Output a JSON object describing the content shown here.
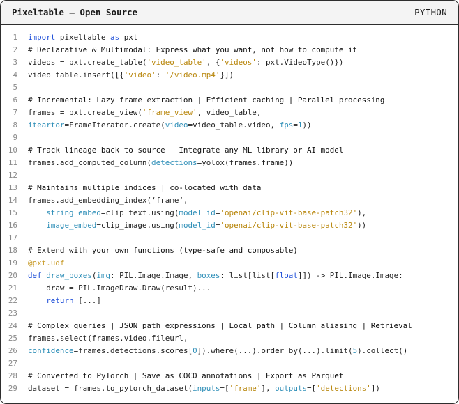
{
  "window": {
    "title": "Pixeltable — Open Source",
    "language": "PYTHON"
  },
  "code_lines": [
    {
      "n": "1",
      "tokens": [
        {
          "c": "kw",
          "t": "import"
        },
        {
          "c": "",
          "t": " pixeltable "
        },
        {
          "c": "kw",
          "t": "as"
        },
        {
          "c": "",
          "t": " pxt"
        }
      ]
    },
    {
      "n": "2",
      "tokens": [
        {
          "c": "cm",
          "t": "# Declarative & Multimodal: Express what you want, not how to compute it"
        }
      ]
    },
    {
      "n": "3",
      "tokens": [
        {
          "c": "",
          "t": "videos = pxt.create_table("
        },
        {
          "c": "st",
          "t": "'video_table'"
        },
        {
          "c": "",
          "t": ", {"
        },
        {
          "c": "st",
          "t": "'videos'"
        },
        {
          "c": "",
          "t": ": pxt.VideoType()})"
        }
      ]
    },
    {
      "n": "4",
      "tokens": [
        {
          "c": "",
          "t": "video_table.insert([{"
        },
        {
          "c": "st",
          "t": "'video'"
        },
        {
          "c": "",
          "t": ": "
        },
        {
          "c": "st",
          "t": "'/video.mp4'"
        },
        {
          "c": "",
          "t": "}])"
        }
      ]
    },
    {
      "n": "5",
      "tokens": []
    },
    {
      "n": "6",
      "tokens": [
        {
          "c": "cm",
          "t": "# Incremental: Lazy frame extraction | Efficient caching | Parallel processing"
        }
      ]
    },
    {
      "n": "7",
      "tokens": [
        {
          "c": "",
          "t": "frames = pxt.create_view("
        },
        {
          "c": "st",
          "t": "'frame_view'"
        },
        {
          "c": "",
          "t": ", video_table,"
        }
      ]
    },
    {
      "n": "8",
      "tokens": [
        {
          "c": "fn",
          "t": "iteartor"
        },
        {
          "c": "",
          "t": "=FrameIterator.create("
        },
        {
          "c": "fn",
          "t": "video"
        },
        {
          "c": "",
          "t": "=video_table.video, "
        },
        {
          "c": "fn",
          "t": "fps"
        },
        {
          "c": "",
          "t": "="
        },
        {
          "c": "nm",
          "t": "1"
        },
        {
          "c": "",
          "t": "))"
        }
      ]
    },
    {
      "n": "9",
      "tokens": []
    },
    {
      "n": "10",
      "tokens": [
        {
          "c": "cm",
          "t": "# Track lineage back to source | Integrate any ML library or AI model"
        }
      ]
    },
    {
      "n": "11",
      "tokens": [
        {
          "c": "",
          "t": "frames.add_computed_column("
        },
        {
          "c": "fn",
          "t": "detections"
        },
        {
          "c": "",
          "t": "=yolox(frames.frame))"
        }
      ]
    },
    {
      "n": "12",
      "tokens": []
    },
    {
      "n": "13",
      "tokens": [
        {
          "c": "cm",
          "t": "# Maintains multiple indices | co-located with data"
        }
      ]
    },
    {
      "n": "14",
      "tokens": [
        {
          "c": "",
          "t": "frames.add_embedding_index(‘frame’,"
        }
      ]
    },
    {
      "n": "15",
      "tokens": [
        {
          "c": "",
          "t": "    "
        },
        {
          "c": "fn",
          "t": "string_embed"
        },
        {
          "c": "",
          "t": "=clip_text.using("
        },
        {
          "c": "fn",
          "t": "model_id"
        },
        {
          "c": "",
          "t": "="
        },
        {
          "c": "st",
          "t": "'openai/clip-vit-base-patch32'"
        },
        {
          "c": "",
          "t": "),"
        }
      ]
    },
    {
      "n": "16",
      "tokens": [
        {
          "c": "",
          "t": "    "
        },
        {
          "c": "fn",
          "t": "image_embed"
        },
        {
          "c": "",
          "t": "=clip_image.using("
        },
        {
          "c": "fn",
          "t": "model_id"
        },
        {
          "c": "",
          "t": "="
        },
        {
          "c": "st",
          "t": "'openai/clip-vit-base-patch32'"
        },
        {
          "c": "",
          "t": "))"
        }
      ]
    },
    {
      "n": "17",
      "tokens": []
    },
    {
      "n": "18",
      "tokens": [
        {
          "c": "cm",
          "t": "# Extend with your own functions (type-safe and composable)"
        }
      ]
    },
    {
      "n": "19",
      "tokens": [
        {
          "c": "at",
          "t": "@pxt.udf"
        }
      ]
    },
    {
      "n": "20",
      "tokens": [
        {
          "c": "kw",
          "t": "def"
        },
        {
          "c": "",
          "t": " "
        },
        {
          "c": "fn",
          "t": "draw_boxes"
        },
        {
          "c": "",
          "t": "("
        },
        {
          "c": "fn",
          "t": "img"
        },
        {
          "c": "",
          "t": ": PIL.Image.Image, "
        },
        {
          "c": "fn",
          "t": "boxes"
        },
        {
          "c": "",
          "t": ": list[list["
        },
        {
          "c": "kw",
          "t": "float"
        },
        {
          "c": "",
          "t": "]]) -> PIL.Image.Image:"
        }
      ]
    },
    {
      "n": "21",
      "tokens": [
        {
          "c": "",
          "t": "    draw = PIL.ImageDraw.Draw(result)..."
        }
      ]
    },
    {
      "n": "22",
      "tokens": [
        {
          "c": "",
          "t": "    "
        },
        {
          "c": "kw",
          "t": "return"
        },
        {
          "c": "",
          "t": " [...]"
        }
      ]
    },
    {
      "n": "23",
      "tokens": []
    },
    {
      "n": "24",
      "tokens": [
        {
          "c": "cm",
          "t": "# Complex queries | JSON path expressions | Local path | Column aliasing | Retrieval"
        }
      ]
    },
    {
      "n": "25",
      "tokens": [
        {
          "c": "",
          "t": "frames.select(frames.video.fileurl,"
        }
      ]
    },
    {
      "n": "26",
      "tokens": [
        {
          "c": "fn",
          "t": "confidence"
        },
        {
          "c": "",
          "t": "=frames.detections.scores["
        },
        {
          "c": "nm",
          "t": "0"
        },
        {
          "c": "",
          "t": "]).where(...).order_by(...).limit("
        },
        {
          "c": "nm",
          "t": "5"
        },
        {
          "c": "",
          "t": ").collect()"
        }
      ]
    },
    {
      "n": "27",
      "tokens": []
    },
    {
      "n": "28",
      "tokens": [
        {
          "c": "cm",
          "t": "# Converted to PyTorch | Save as COCO annotations | Export as Parquet"
        }
      ]
    },
    {
      "n": "29",
      "tokens": [
        {
          "c": "",
          "t": "dataset = frames.to_pytorch_dataset("
        },
        {
          "c": "fn",
          "t": "inputs"
        },
        {
          "c": "",
          "t": "=["
        },
        {
          "c": "st",
          "t": "'frame'"
        },
        {
          "c": "",
          "t": "], "
        },
        {
          "c": "fn",
          "t": "outputs"
        },
        {
          "c": "",
          "t": "=["
        },
        {
          "c": "st",
          "t": "'detections'"
        },
        {
          "c": "",
          "t": "])"
        }
      ]
    }
  ]
}
